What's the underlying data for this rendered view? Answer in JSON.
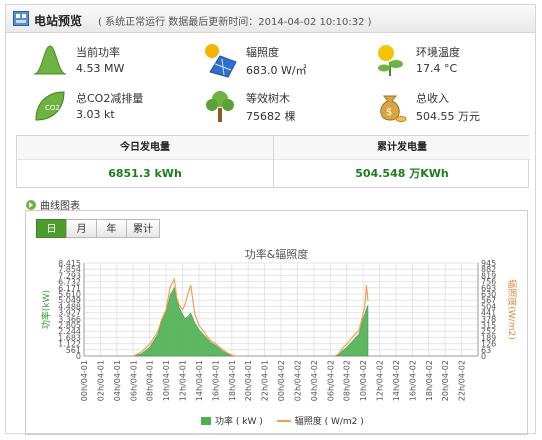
{
  "header": {
    "title": "电站预览",
    "status": "( 系统正常运行  数据最后更新时间：2014-04-02 10:10:32 )"
  },
  "metrics": [
    {
      "label": "当前功率",
      "value": "4.53 MW",
      "icon": "power-curve-icon"
    },
    {
      "label": "辐照度",
      "value": "683.0 W/㎡",
      "icon": "solar-panel-icon"
    },
    {
      "label": "环境温度",
      "value": "17.4 °C",
      "icon": "sun-plant-icon"
    },
    {
      "label": "总CO2减排量",
      "value": "3.03 kt",
      "icon": "leaf-co2-icon"
    },
    {
      "label": "等效树木",
      "value": "75682 棵",
      "icon": "tree-icon"
    },
    {
      "label": "总收入",
      "value": "504.55 万元",
      "icon": "money-bag-icon"
    }
  ],
  "energy": {
    "today_label": "今日发电量",
    "today_value": "6851.3 kWh",
    "total_label": "累计发电量",
    "total_value": "504.548 万KWh"
  },
  "curve_section": {
    "title": "曲线图表"
  },
  "tabs": [
    {
      "label": "日",
      "active": true
    },
    {
      "label": "月",
      "active": false
    },
    {
      "label": "年",
      "active": false
    },
    {
      "label": "累计",
      "active": false
    }
  ],
  "colors": {
    "power": "#4caf50",
    "irradiance": "#f0a050",
    "accent_green": "#1b7e1b",
    "tab_active": "#4d9d2e"
  },
  "chart_data": {
    "type": "area",
    "title": "功率&辐照度",
    "ylabel_left": "功率(kW)",
    "ylabel_right": "辐照度(W/m2)",
    "ylim_left": [
      0,
      8.415
    ],
    "ylim_right": [
      0,
      945
    ],
    "yticks_left": [
      "8.415",
      "7.854",
      "7.293",
      "6.732",
      "6.171",
      "5.610",
      "5.049",
      "4.488",
      "3.927",
      "3.366",
      "2.805",
      "2.244",
      "1.683",
      "1.122",
      "561",
      "0"
    ],
    "yticks_right": [
      "945",
      "882",
      "819",
      "756",
      "693",
      "630",
      "567",
      "504",
      "441",
      "378",
      "315",
      "252",
      "189",
      "126",
      "63",
      "0"
    ],
    "xticks": [
      "00h/04-01",
      "02h/04-01",
      "04h/04-01",
      "06h/04-01",
      "08h/04-01",
      "10h/04-01",
      "12h/04-01",
      "14h/04-01",
      "16h/04-01",
      "18h/04-01",
      "20h/04-01",
      "22h/04-01",
      "00h/04-02",
      "02h/04-02",
      "04h/04-02",
      "06h/04-02",
      "08h/04-02",
      "10h/04-02",
      "12h/04-02",
      "14h/04-02",
      "16h/04-02",
      "18h/04-02",
      "20h/04-02",
      "22h/04-02"
    ],
    "x_hours": [
      6,
      7,
      8,
      9,
      9.5,
      10,
      10.5,
      11,
      11.3,
      11.6,
      12,
      12.3,
      12.7,
      13,
      13.5,
      14,
      14.5,
      15,
      15.5,
      16,
      16.5,
      17,
      17.5,
      18,
      18.5,
      30.5,
      31,
      31.5,
      32,
      32.5,
      33,
      33.5,
      34,
      34.2,
      34.4,
      34.6
    ],
    "series": [
      {
        "name": "功率 ( kW )",
        "axis": "left",
        "values": [
          0,
          0.2,
          0.8,
          2.0,
          3.2,
          4.0,
          5.5,
          6.2,
          5.0,
          4.4,
          3.8,
          3.4,
          3.6,
          3.9,
          3.0,
          2.4,
          2.0,
          1.6,
          1.2,
          1.0,
          0.7,
          0.4,
          0.2,
          0.1,
          0,
          0,
          0.1,
          0.5,
          0.8,
          1.2,
          1.6,
          2.0,
          3.4,
          3.8,
          4.3,
          4.6
        ]
      },
      {
        "name": "辐照度 ( W/m2 )",
        "axis": "right",
        "values": [
          0,
          40,
          120,
          250,
          380,
          470,
          700,
          780,
          590,
          520,
          470,
          520,
          640,
          720,
          430,
          310,
          260,
          200,
          150,
          130,
          90,
          60,
          30,
          10,
          0,
          0,
          20,
          80,
          120,
          170,
          220,
          260,
          430,
          500,
          720,
          560
        ]
      }
    ],
    "legend": [
      "功率 ( kW )",
      "辐照度 ( W/m2 )"
    ],
    "legend_position": "bottom",
    "grid": true
  }
}
